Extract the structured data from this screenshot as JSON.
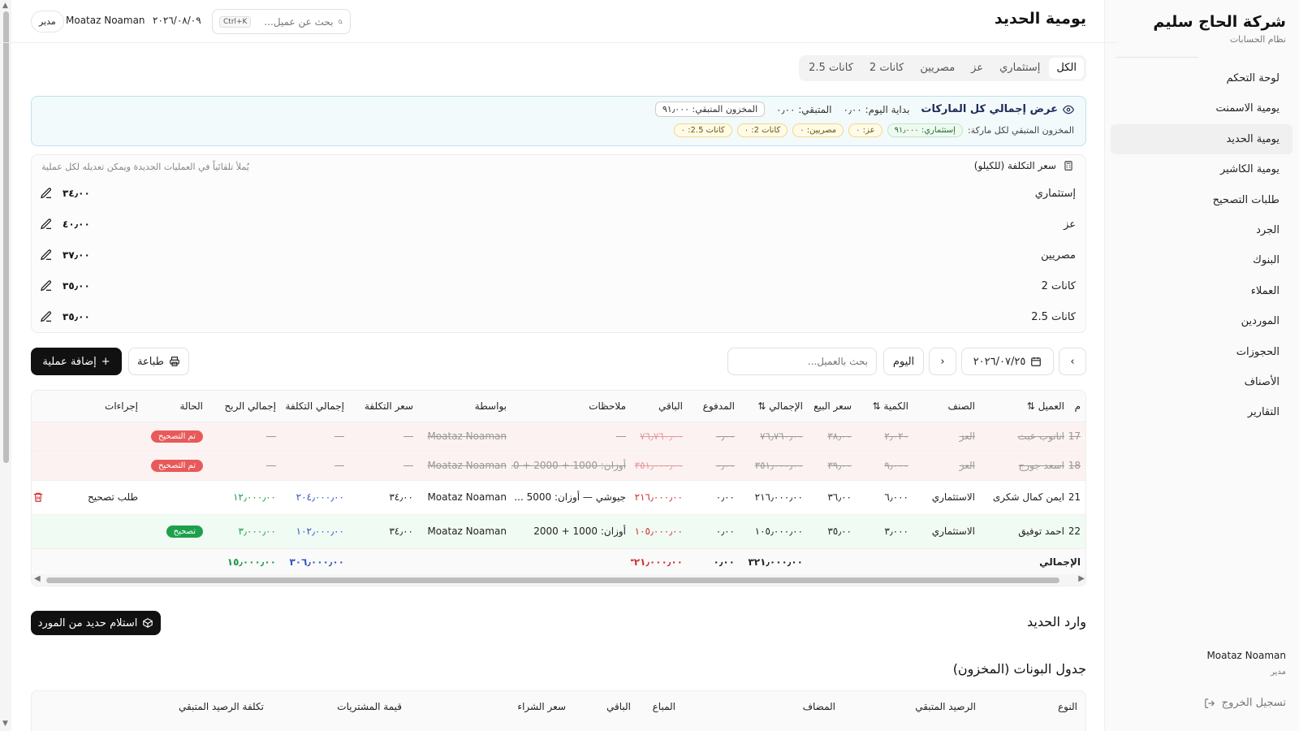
{
  "sidebar": {
    "company": "شركة الحاج سليم",
    "subtitle": "نظام الحسابات",
    "items": [
      {
        "label": "لوحة التحكم"
      },
      {
        "label": "يومية الاسمنت"
      },
      {
        "label": "يومية الحديد"
      },
      {
        "label": "يومية الكاشير"
      },
      {
        "label": "طلبات التصحيح"
      },
      {
        "label": "الجرد"
      },
      {
        "label": "البنوك"
      },
      {
        "label": "العملاء"
      },
      {
        "label": "الموردين"
      },
      {
        "label": "الحجوزات"
      },
      {
        "label": "الأصناف"
      },
      {
        "label": "التقارير"
      }
    ],
    "user_name": "Moataz Noaman",
    "user_role": "مدير",
    "logout": "تسجيل الخروج"
  },
  "header": {
    "title": "يومية الحديد",
    "search_placeholder": "بحث عن عميل...",
    "shortcut": "Ctrl+K",
    "date": "٢٠٢٦/٠٨/٠٩",
    "user": "Moataz Noaman",
    "role": "مدير"
  },
  "tabs": [
    "الكل",
    "إستثماري",
    "عز",
    "مصريين",
    "كانات 2",
    "كانات 2.5"
  ],
  "summary": {
    "title": "عرض إجمالي كل الماركات",
    "start_label": "بداية اليوم: ٠٫٠٠",
    "remaining_label": "المتبقي: ٠٫٠٠",
    "stock_label": "المخزون المتبقي: ٩١٫٠٠٠",
    "per_brand_label": "المخزون المتبقي لكل ماركة:",
    "chips": [
      {
        "text": "إستثماري: ٩١٫٠٠٠",
        "color": "green"
      },
      {
        "text": "عز: ٠",
        "color": "yellow"
      },
      {
        "text": "مصريين: ٠",
        "color": "yellow"
      },
      {
        "text": "كانات 2: ٠",
        "color": "yellow"
      },
      {
        "text": "كانات 2.5: ٠",
        "color": "yellow"
      }
    ]
  },
  "cost": {
    "title": "سعر التكلفة (للكيلو)",
    "note": "يُملأ تلقائياً في العمليات الجديدة ويمكن تعديله لكل عملية",
    "rows": [
      {
        "name": "إستثماري",
        "value": "٣٤٫٠٠"
      },
      {
        "name": "عز",
        "value": "٤٠٫٠٠"
      },
      {
        "name": "مصريين",
        "value": "٣٧٫٠٠"
      },
      {
        "name": "كانات 2",
        "value": "٣٥٫٠٠"
      },
      {
        "name": "كانات 2.5",
        "value": "٣٥٫٠٠"
      }
    ]
  },
  "toolbar": {
    "date": "٢٠٢٦/٠٧/٢٥",
    "today": "اليوم",
    "client_search_placeholder": "بحث بالعميل...",
    "print": "طباعة",
    "add": "إضافة عملية"
  },
  "table": {
    "headers": [
      "م",
      "العميل",
      "الصنف",
      "الكمية",
      "سعر البيع",
      "الإجمالي",
      "المدفوع",
      "الباقي",
      "ملاحظات",
      "بواسطة",
      "سعر التكلفة",
      "إجمالي التكلفة",
      "إجمالي الربح",
      "الحالة",
      "إجراءات"
    ],
    "rows": [
      {
        "no": "17",
        "client": "انانوب عبث",
        "item": "العز",
        "qty": "٢٫٠٢٠",
        "price": "٣٨٫٠٠",
        "total": "٧٦٫٧٦٠٫٠٠",
        "paid": "٠٫٠٠",
        "rest": "٧٦٫٧٦٠٫٠٠",
        "notes": "—",
        "by": "Moataz Noaman",
        "cost": "—",
        "total_cost": "—",
        "profit": "—",
        "status": "تم التصحيح",
        "action": ""
      },
      {
        "no": "18",
        "client": "اسعد جورج",
        "item": "العز",
        "qty": "٩٫٠٠٠",
        "price": "٣٩٫٠٠",
        "total": "٣٥١٫٠٠٠٫٠٠",
        "paid": "٠٫٠٠",
        "rest": "٣٥١٫٠٠٠٫٠٠",
        "notes": "أوزان: 1000 + 2000 + 0...",
        "by": "Moataz Noaman",
        "cost": "—",
        "total_cost": "—",
        "profit": "—",
        "status": "تم التصحيح",
        "action": ""
      },
      {
        "no": "21",
        "client": "ايمن كمال شكرى",
        "item": "الاستثماري",
        "qty": "٦٫٠٠٠",
        "price": "٣٦٫٠٠",
        "total": "٢١٦٫٠٠٠٫٠٠",
        "paid": "٠٫٠٠",
        "rest": "٢١٦٫٠٠٠٫٠٠",
        "notes": "جيوشي — أوزان: 5000 ...",
        "by": "Moataz Noaman",
        "cost": "٣٤٫٠٠",
        "total_cost": "٢٠٤٫٠٠٠٫٠٠",
        "profit": "١٢٫٠٠٠٫٠٠",
        "status": "",
        "action": "طلب تصحيح"
      },
      {
        "no": "22",
        "client": "احمد توفيق",
        "item": "الاستثماري",
        "qty": "٣٫٠٠٠",
        "price": "٣٥٫٠٠",
        "total": "١٠٥٫٠٠٠٫٠٠",
        "paid": "٠٫٠٠",
        "rest": "١٠٥٫٠٠٠٫٠٠",
        "notes": "أوزان: 1000 + 2000",
        "by": "Moataz Noaman",
        "cost": "٣٤٫٠٠",
        "total_cost": "١٠٢٫٠٠٠٫٠٠",
        "profit": "٣٫٠٠٠٫٠٠",
        "status": "تصحيح",
        "action": ""
      }
    ],
    "totals": {
      "label": "الإجمالي",
      "total": "٣٢١٫٠٠٠٫٠٠",
      "paid": "٠٫٠٠",
      "rest": "٣٢١٫٠٠٠٫٠٠",
      "total_cost": "٣٠٦٫٠٠٠٫٠٠",
      "profit": "١٥٫٠٠٠٫٠٠"
    }
  },
  "inbound": {
    "title": "وارد الحديد",
    "button": "استلام حديد من المورد"
  },
  "inventory": {
    "title": "جدول البونات (المخزون)",
    "headers": [
      "النوع",
      "الرصيد المتبقي",
      "المضاف",
      "المباع",
      "الباقي",
      "سعر الشراء",
      "قيمة المشتريات",
      "تكلفة الرصيد المتبقي"
    ]
  }
}
